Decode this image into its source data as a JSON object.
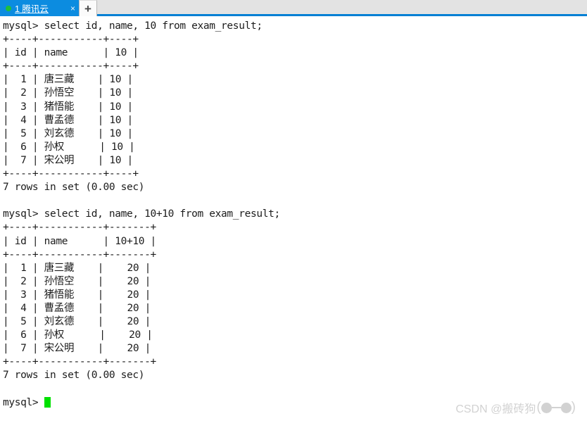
{
  "window": {
    "tab": {
      "title": "1 腾讯云",
      "status_dot": "green-status-dot",
      "close_label": "×"
    },
    "new_tab_label": "+"
  },
  "terminal": {
    "lines": [
      "mysql> select id, name, 10 from exam_result;",
      "+----+-----------+----+",
      "| id | name      | 10 |",
      "+----+-----------+----+",
      "|  1 | 唐三藏    | 10 |",
      "|  2 | 孙悟空    | 10 |",
      "|  3 | 猪悟能    | 10 |",
      "|  4 | 曹孟德    | 10 |",
      "|  5 | 刘玄德    | 10 |",
      "|  6 | 孙权      | 10 |",
      "|  7 | 宋公明    | 10 |",
      "+----+-----------+----+",
      "7 rows in set (0.00 sec)",
      "",
      "mysql> select id, name, 10+10 from exam_result;",
      "+----+-----------+-------+",
      "| id | name      | 10+10 |",
      "+----+-----------+-------+",
      "|  1 | 唐三藏    |    20 |",
      "|  2 | 孙悟空    |    20 |",
      "|  3 | 猪悟能    |    20 |",
      "|  4 | 曹孟德    |    20 |",
      "|  5 | 刘玄德    |    20 |",
      "|  6 | 孙权      |    20 |",
      "|  7 | 宋公明    |    20 |",
      "+----+-----------+-------+",
      "7 rows in set (0.00 sec)",
      "",
      "mysql> "
    ],
    "prompt": "mysql> ",
    "queries": [
      {
        "sql": "select id, name, 10 from exam_result;",
        "columns": [
          "id",
          "name",
          "10"
        ],
        "rows": [
          [
            "1",
            "唐三藏",
            "10"
          ],
          [
            "2",
            "孙悟空",
            "10"
          ],
          [
            "3",
            "猪悟能",
            "10"
          ],
          [
            "4",
            "曹孟德",
            "10"
          ],
          [
            "5",
            "刘玄德",
            "10"
          ],
          [
            "6",
            "孙权",
            "10"
          ],
          [
            "7",
            "宋公明",
            "10"
          ]
        ],
        "result_status": "7 rows in set (0.00 sec)"
      },
      {
        "sql": "select id, name, 10+10 from exam_result;",
        "columns": [
          "id",
          "name",
          "10+10"
        ],
        "rows": [
          [
            "1",
            "唐三藏",
            "20"
          ],
          [
            "2",
            "孙悟空",
            "20"
          ],
          [
            "3",
            "猪悟能",
            "20"
          ],
          [
            "4",
            "曹孟德",
            "20"
          ],
          [
            "5",
            "刘玄德",
            "20"
          ],
          [
            "6",
            "孙权",
            "20"
          ],
          [
            "7",
            "宋公明",
            "20"
          ]
        ],
        "result_status": "7 rows in set (0.00 sec)"
      }
    ],
    "cursor_color": "#00e000"
  },
  "watermark": {
    "text": "CSDN @搬砖狗",
    "face_open": "(",
    "face_close": ")",
    "color": "#d2d2d2"
  }
}
